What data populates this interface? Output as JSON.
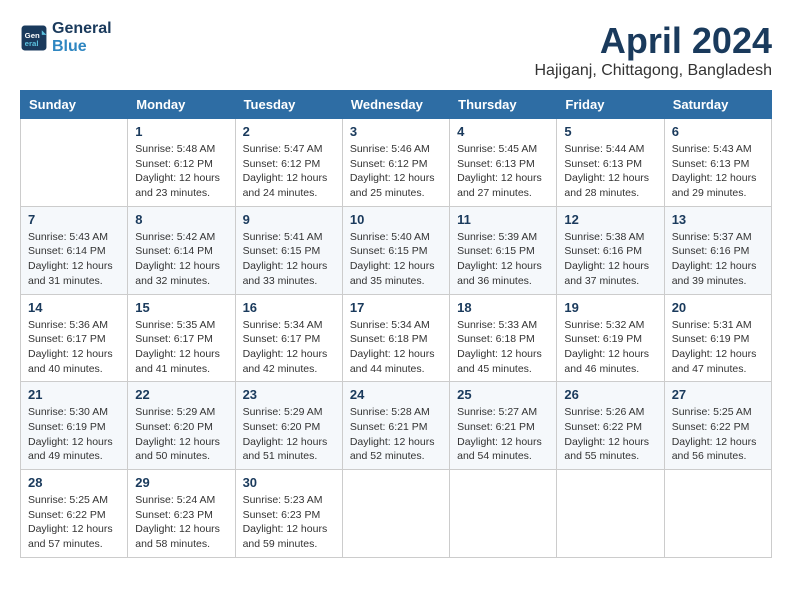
{
  "header": {
    "logo_line1": "General",
    "logo_line2": "Blue",
    "month_title": "April 2024",
    "location": "Hajiganj, Chittagong, Bangladesh"
  },
  "columns": [
    "Sunday",
    "Monday",
    "Tuesday",
    "Wednesday",
    "Thursday",
    "Friday",
    "Saturday"
  ],
  "weeks": [
    [
      {
        "day": "",
        "info": ""
      },
      {
        "day": "1",
        "info": "Sunrise: 5:48 AM\nSunset: 6:12 PM\nDaylight: 12 hours\nand 23 minutes."
      },
      {
        "day": "2",
        "info": "Sunrise: 5:47 AM\nSunset: 6:12 PM\nDaylight: 12 hours\nand 24 minutes."
      },
      {
        "day": "3",
        "info": "Sunrise: 5:46 AM\nSunset: 6:12 PM\nDaylight: 12 hours\nand 25 minutes."
      },
      {
        "day": "4",
        "info": "Sunrise: 5:45 AM\nSunset: 6:13 PM\nDaylight: 12 hours\nand 27 minutes."
      },
      {
        "day": "5",
        "info": "Sunrise: 5:44 AM\nSunset: 6:13 PM\nDaylight: 12 hours\nand 28 minutes."
      },
      {
        "day": "6",
        "info": "Sunrise: 5:43 AM\nSunset: 6:13 PM\nDaylight: 12 hours\nand 29 minutes."
      }
    ],
    [
      {
        "day": "7",
        "info": "Sunrise: 5:43 AM\nSunset: 6:14 PM\nDaylight: 12 hours\nand 31 minutes."
      },
      {
        "day": "8",
        "info": "Sunrise: 5:42 AM\nSunset: 6:14 PM\nDaylight: 12 hours\nand 32 minutes."
      },
      {
        "day": "9",
        "info": "Sunrise: 5:41 AM\nSunset: 6:15 PM\nDaylight: 12 hours\nand 33 minutes."
      },
      {
        "day": "10",
        "info": "Sunrise: 5:40 AM\nSunset: 6:15 PM\nDaylight: 12 hours\nand 35 minutes."
      },
      {
        "day": "11",
        "info": "Sunrise: 5:39 AM\nSunset: 6:15 PM\nDaylight: 12 hours\nand 36 minutes."
      },
      {
        "day": "12",
        "info": "Sunrise: 5:38 AM\nSunset: 6:16 PM\nDaylight: 12 hours\nand 37 minutes."
      },
      {
        "day": "13",
        "info": "Sunrise: 5:37 AM\nSunset: 6:16 PM\nDaylight: 12 hours\nand 39 minutes."
      }
    ],
    [
      {
        "day": "14",
        "info": "Sunrise: 5:36 AM\nSunset: 6:17 PM\nDaylight: 12 hours\nand 40 minutes."
      },
      {
        "day": "15",
        "info": "Sunrise: 5:35 AM\nSunset: 6:17 PM\nDaylight: 12 hours\nand 41 minutes."
      },
      {
        "day": "16",
        "info": "Sunrise: 5:34 AM\nSunset: 6:17 PM\nDaylight: 12 hours\nand 42 minutes."
      },
      {
        "day": "17",
        "info": "Sunrise: 5:34 AM\nSunset: 6:18 PM\nDaylight: 12 hours\nand 44 minutes."
      },
      {
        "day": "18",
        "info": "Sunrise: 5:33 AM\nSunset: 6:18 PM\nDaylight: 12 hours\nand 45 minutes."
      },
      {
        "day": "19",
        "info": "Sunrise: 5:32 AM\nSunset: 6:19 PM\nDaylight: 12 hours\nand 46 minutes."
      },
      {
        "day": "20",
        "info": "Sunrise: 5:31 AM\nSunset: 6:19 PM\nDaylight: 12 hours\nand 47 minutes."
      }
    ],
    [
      {
        "day": "21",
        "info": "Sunrise: 5:30 AM\nSunset: 6:19 PM\nDaylight: 12 hours\nand 49 minutes."
      },
      {
        "day": "22",
        "info": "Sunrise: 5:29 AM\nSunset: 6:20 PM\nDaylight: 12 hours\nand 50 minutes."
      },
      {
        "day": "23",
        "info": "Sunrise: 5:29 AM\nSunset: 6:20 PM\nDaylight: 12 hours\nand 51 minutes."
      },
      {
        "day": "24",
        "info": "Sunrise: 5:28 AM\nSunset: 6:21 PM\nDaylight: 12 hours\nand 52 minutes."
      },
      {
        "day": "25",
        "info": "Sunrise: 5:27 AM\nSunset: 6:21 PM\nDaylight: 12 hours\nand 54 minutes."
      },
      {
        "day": "26",
        "info": "Sunrise: 5:26 AM\nSunset: 6:22 PM\nDaylight: 12 hours\nand 55 minutes."
      },
      {
        "day": "27",
        "info": "Sunrise: 5:25 AM\nSunset: 6:22 PM\nDaylight: 12 hours\nand 56 minutes."
      }
    ],
    [
      {
        "day": "28",
        "info": "Sunrise: 5:25 AM\nSunset: 6:22 PM\nDaylight: 12 hours\nand 57 minutes."
      },
      {
        "day": "29",
        "info": "Sunrise: 5:24 AM\nSunset: 6:23 PM\nDaylight: 12 hours\nand 58 minutes."
      },
      {
        "day": "30",
        "info": "Sunrise: 5:23 AM\nSunset: 6:23 PM\nDaylight: 12 hours\nand 59 minutes."
      },
      {
        "day": "",
        "info": ""
      },
      {
        "day": "",
        "info": ""
      },
      {
        "day": "",
        "info": ""
      },
      {
        "day": "",
        "info": ""
      }
    ]
  ]
}
